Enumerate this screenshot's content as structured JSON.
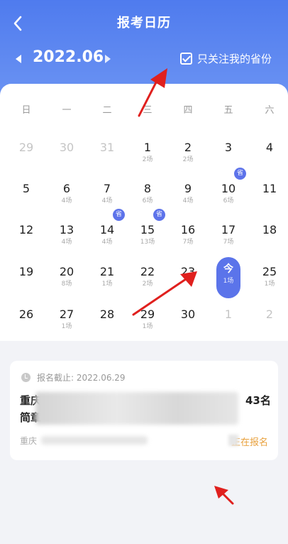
{
  "header": {
    "title": "报考日历",
    "back_icon": "chevron-left-icon",
    "month": "2022.06",
    "filter_label": "只关注我的省份",
    "filter_checked": true
  },
  "calendar": {
    "weekdays": [
      "日",
      "一",
      "二",
      "三",
      "四",
      "五",
      "六"
    ],
    "weeks": [
      [
        {
          "day": "29",
          "other": true
        },
        {
          "day": "30",
          "other": true
        },
        {
          "day": "31",
          "other": true
        },
        {
          "day": "1",
          "count": "2场"
        },
        {
          "day": "2",
          "count": "2场"
        },
        {
          "day": "3"
        },
        {
          "day": "4"
        }
      ],
      [
        {
          "day": "5"
        },
        {
          "day": "6",
          "count": "4场"
        },
        {
          "day": "7",
          "count": "4场"
        },
        {
          "day": "8",
          "count": "6场"
        },
        {
          "day": "9",
          "count": "4场"
        },
        {
          "day": "10",
          "count": "6场",
          "badge": "省"
        },
        {
          "day": "11"
        }
      ],
      [
        {
          "day": "12"
        },
        {
          "day": "13",
          "count": "4场"
        },
        {
          "day": "14",
          "count": "4场",
          "badge": "省"
        },
        {
          "day": "15",
          "count": "13场",
          "badge": "省"
        },
        {
          "day": "16",
          "count": "7场"
        },
        {
          "day": "17",
          "count": "7场"
        },
        {
          "day": "18"
        }
      ],
      [
        {
          "day": "19"
        },
        {
          "day": "20",
          "count": "8场"
        },
        {
          "day": "21",
          "count": "1场"
        },
        {
          "day": "22",
          "count": "2场"
        },
        {
          "day": "23"
        },
        {
          "day": "今",
          "count": "1场",
          "today": true
        },
        {
          "day": "25",
          "count": "1场"
        }
      ],
      [
        {
          "day": "26"
        },
        {
          "day": "27",
          "count": "1场"
        },
        {
          "day": "28"
        },
        {
          "day": "29",
          "count": "1场"
        },
        {
          "day": "30"
        },
        {
          "day": "1",
          "other": true
        },
        {
          "day": "2",
          "other": true
        }
      ]
    ]
  },
  "notice": {
    "clock_icon": "clock-icon",
    "deadline": "报名截止: 2022.06.29",
    "title_start": "重庆",
    "title_end": "43名",
    "title_line2_start": "简章",
    "region": "重庆",
    "status": "正在报名",
    "status_color": "#e8a13e"
  },
  "colors": {
    "accent": "#5b74ea",
    "header_top": "#4f7bee",
    "annotation_arrow": "#e0201e"
  }
}
